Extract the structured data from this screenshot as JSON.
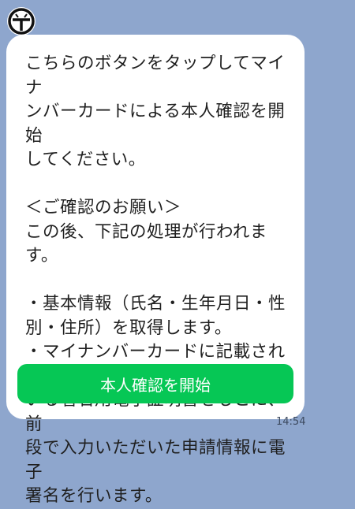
{
  "message": {
    "body": "こちらのボタンをタップしてマイナ\nンバーカードによる本人確認を開始\nしてください。\n\n＜ご確認のお願い＞\nこの後、下記の処理が行われます。\n\n・基本情報（氏名・生年月日・性\n別・住所）を取得します。\n・マイナンバーカードに記載されて\nいる署名用電子証明書をもとに、前\n段で入力いただいた申請情報に電子\n署名を行います。",
    "button_label": "本人確認を開始",
    "time": "14:54"
  },
  "colors": {
    "background": "#8ea6cd",
    "button": "#06c755",
    "bubble": "#ffffff"
  },
  "icons": {
    "avatar": "logo-icon"
  }
}
